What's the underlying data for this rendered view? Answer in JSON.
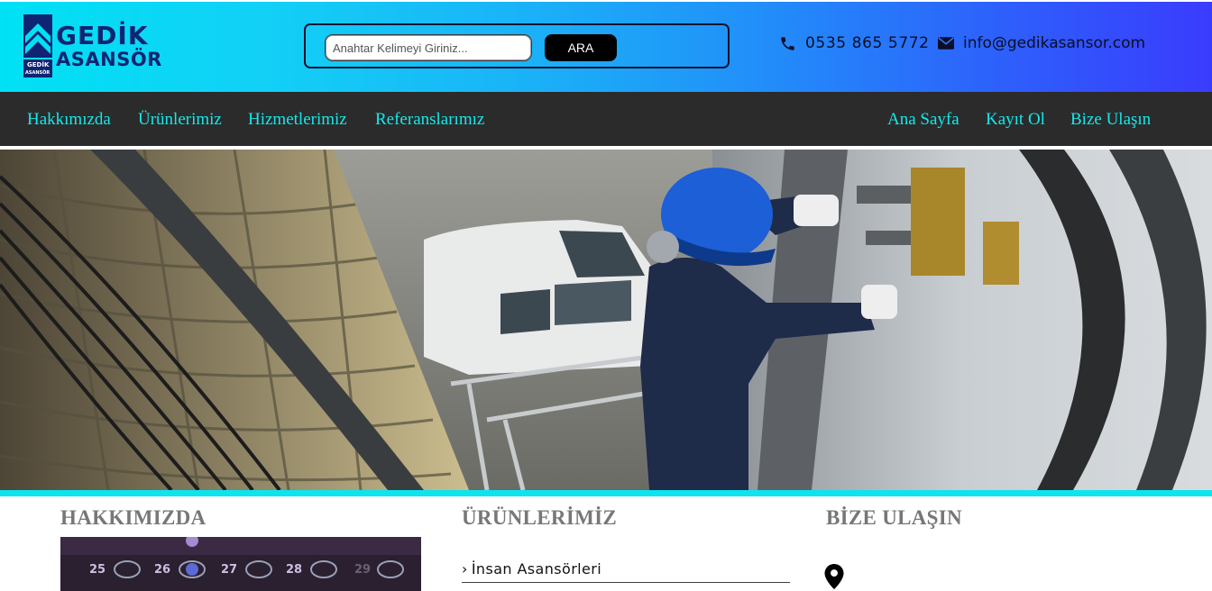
{
  "brand": {
    "name_line1": "GEDİK",
    "name_line2": "ASANSÖR",
    "mini_line1": "GEDİK",
    "mini_line2": "ASANSÖR",
    "color": "#0f2573"
  },
  "search": {
    "placeholder": "Anahtar Kelimeyi Giriniz...",
    "value": "",
    "button_label": "ARA"
  },
  "contact": {
    "phone": "0535 865 5772",
    "email": "info@gedikasansor.com",
    "phone_icon": "phone-icon",
    "email_icon": "envelope-icon"
  },
  "nav": {
    "left_items": [
      "Hakkımızda",
      "Ürünlerimiz",
      "Hizmetlerimiz",
      "Referanslarımız"
    ],
    "right_items": [
      "Ana Sayfa",
      "Kayıt Ol",
      "Bize Ulaşın"
    ]
  },
  "sections": {
    "about_title": "HAKKIMIZDA",
    "products_title": "ÜRÜNLERİMİZ",
    "contact_title": "BİZE ULAŞIN",
    "products": [
      {
        "label": "İnsan Asansörleri",
        "chevron": "›"
      }
    ],
    "elevator_buttons": [
      "25",
      "26",
      "27",
      "28",
      "29"
    ],
    "location_icon": "map-marker-icon"
  },
  "colors": {
    "header_gradient_start": "#00e1f4",
    "header_gradient_end": "#3a3cfd",
    "nav_background": "#2b2b2b",
    "nav_link": "#16e8ec",
    "accent_bar": "#0de4ee",
    "section_title": "#777777"
  }
}
